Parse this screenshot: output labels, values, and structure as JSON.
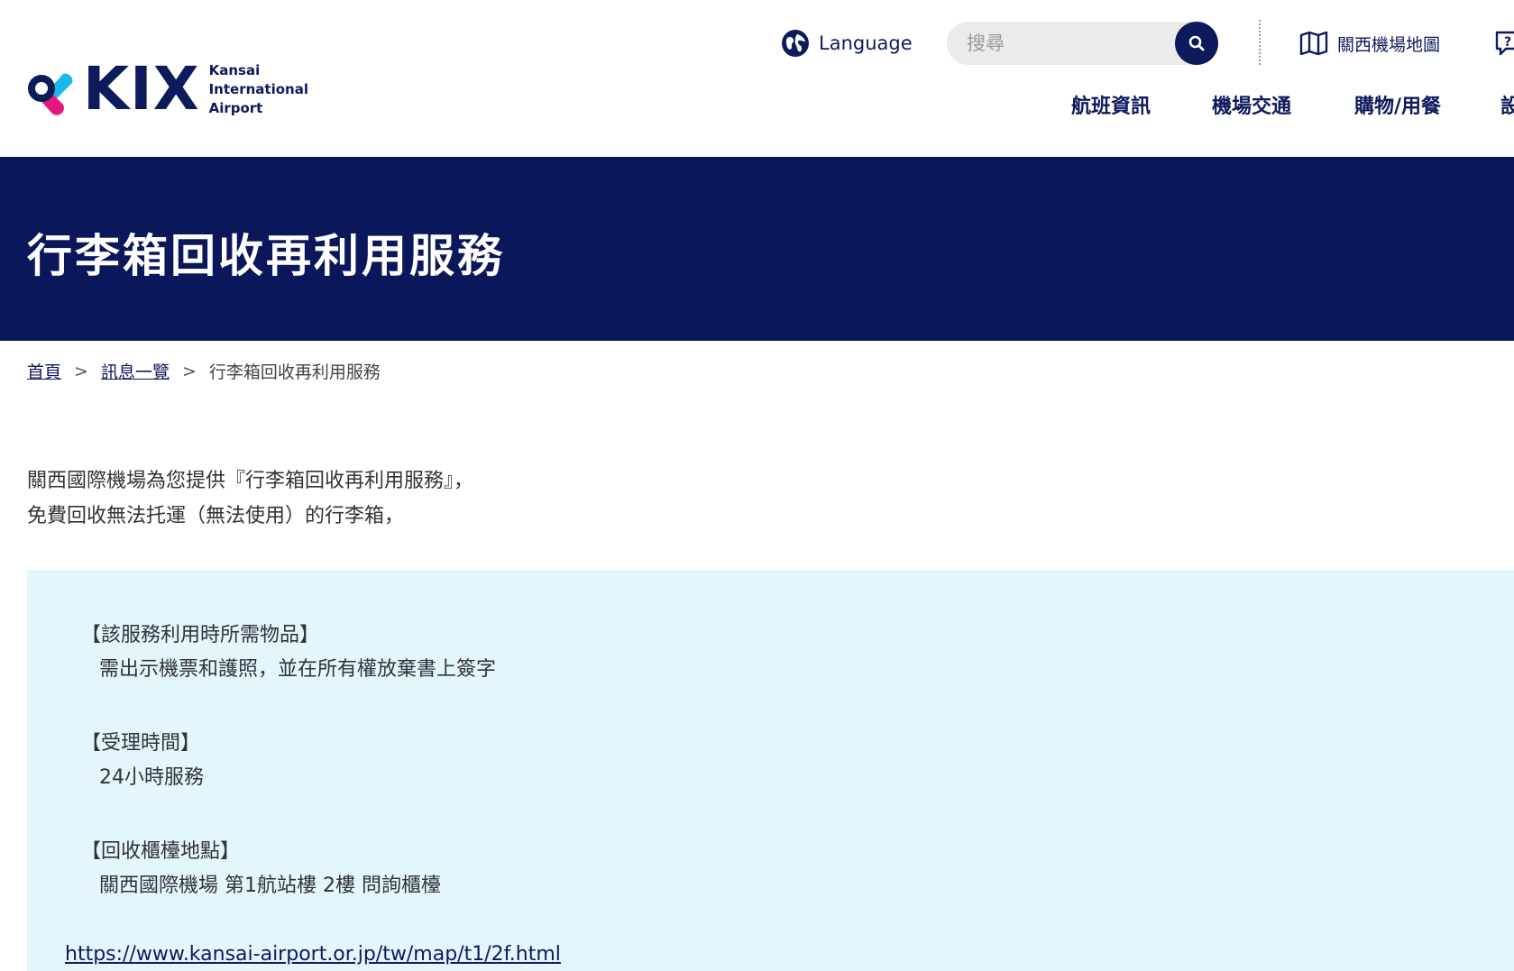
{
  "header": {
    "logo": {
      "wordmark": "KIX",
      "subtitle_lines": [
        "Kansai",
        "International",
        "Airport"
      ],
      "brand_colors": {
        "navy": "#0d1a5c",
        "cyan": "#1ab8e8",
        "magenta": "#e6177a"
      }
    },
    "language_label": "Language",
    "search": {
      "placeholder": "搜尋"
    },
    "map_link_label": "關西機場地圖",
    "nav": [
      {
        "label": "航班資訊"
      },
      {
        "label": "機場交通"
      },
      {
        "label": "購物/用餐"
      },
      {
        "label": "設"
      }
    ]
  },
  "page_title": "行李箱回收再利用服務",
  "breadcrumb": {
    "items": [
      "首頁",
      "訊息一覽"
    ],
    "current": "行李箱回收再利用服務",
    "separator": ">"
  },
  "intro": [
    "關西國際機場為您提供『行李箱回收再利用服務』，",
    "免費回收無法托運（無法使用）的行李箱，"
  ],
  "sections": [
    {
      "heading": "【該服務利用時所需物品】",
      "body": "需出示機票和護照，並在所有權放棄書上簽字"
    },
    {
      "heading": "【受理時間】",
      "body": " 24小時服務"
    },
    {
      "heading": "【回收櫃檯地點】",
      "body": "關西國際機場 第1航站樓 2樓 問詢櫃檯"
    }
  ],
  "location_link": "https://www.kansai-airport.or.jp/tw/map/t1/2f.html",
  "colors": {
    "header_band": "#0a175a",
    "info_box_bg": "#e2f6fc",
    "text": "#333333",
    "link": "#0d1a5c"
  },
  "icons": {
    "language": "globe-icon",
    "search": "search-icon",
    "map": "map-book-icon",
    "help": "help-bubble-icon"
  }
}
